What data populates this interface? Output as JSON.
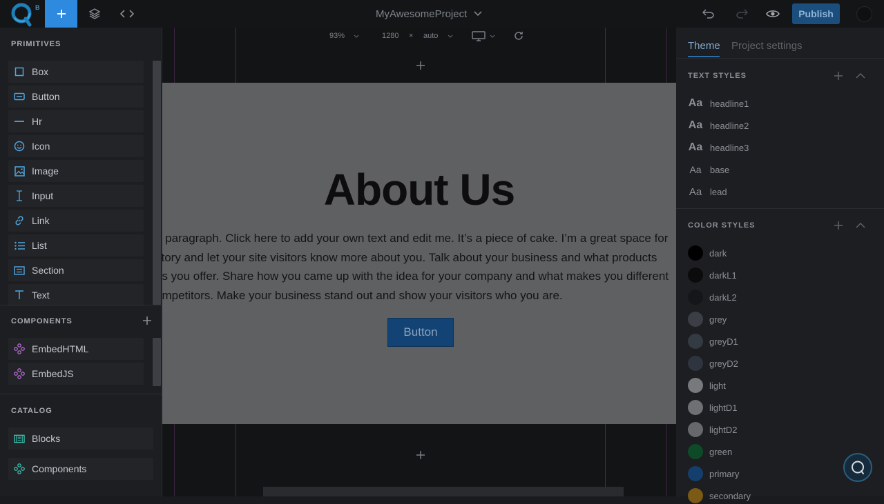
{
  "topbar": {
    "logo_badge": "B",
    "project_name": "MyAwesomeProject",
    "publish_label": "Publish"
  },
  "left_panel": {
    "primitives_title": "PRIMITIVES",
    "primitives": [
      {
        "label": "Box",
        "icon": "box-icon"
      },
      {
        "label": "Button",
        "icon": "button-icon"
      },
      {
        "label": "Hr",
        "icon": "hr-icon"
      },
      {
        "label": "Icon",
        "icon": "smiley-icon"
      },
      {
        "label": "Image",
        "icon": "image-icon"
      },
      {
        "label": "Input",
        "icon": "text-cursor-icon"
      },
      {
        "label": "Link",
        "icon": "link-icon"
      },
      {
        "label": "List",
        "icon": "list-icon"
      },
      {
        "label": "Section",
        "icon": "section-icon"
      },
      {
        "label": "Text",
        "icon": "text-icon"
      }
    ],
    "components_title": "COMPONENTS",
    "components": [
      {
        "label": "EmbedHTML",
        "icon": "component-icon"
      },
      {
        "label": "EmbedJS",
        "icon": "component-icon"
      }
    ],
    "catalog_title": "CATALOG",
    "catalog": [
      {
        "label": "Blocks",
        "icon": "blocks-icon"
      },
      {
        "label": "Components",
        "icon": "component-icon"
      }
    ]
  },
  "canvas": {
    "zoom": "93%",
    "width": "1280",
    "times": "×",
    "height": "auto",
    "page": {
      "title": "About Us",
      "paragraph_lines": [
        "a paragraph. Click here to add your own text and edit me. It’s a piece of cake. I’m a great space for",
        " story and let your site visitors know more about you. Talk about your business and what products",
        "es you offer. Share how you came up with the idea for your company and what makes you different",
        "ompetitors. Make your business stand out and show your visitors who you are."
      ],
      "button_label": "Button"
    }
  },
  "right_panel": {
    "tabs": [
      "Theme",
      "Project settings"
    ],
    "text_styles_title": "TEXT STYLES",
    "text_styles": [
      {
        "glyph": "Aa",
        "name": "headline1"
      },
      {
        "glyph": "Aa",
        "name": "headline2"
      },
      {
        "glyph": "Aa",
        "name": "headline3"
      },
      {
        "glyph": "Aa",
        "name": "base"
      },
      {
        "glyph": "Aa",
        "name": "lead"
      }
    ],
    "color_styles_title": "COLOR STYLES",
    "color_styles": [
      {
        "name": "dark",
        "color": "#000000"
      },
      {
        "name": "darkL1",
        "color": "#0b0b0c"
      },
      {
        "name": "darkL2",
        "color": "#151618"
      },
      {
        "name": "grey",
        "color": "#3b3f45"
      },
      {
        "name": "greyD1",
        "color": "#343a42"
      },
      {
        "name": "greyD2",
        "color": "#2f353e"
      },
      {
        "name": "light",
        "color": "#77797d"
      },
      {
        "name": "lightD1",
        "color": "#6e7074"
      },
      {
        "name": "lightD2",
        "color": "#66686c"
      },
      {
        "name": "green",
        "color": "#0f4a28"
      },
      {
        "name": "primary",
        "color": "#143f6c"
      },
      {
        "name": "secondary",
        "color": "#7a5a14"
      }
    ]
  },
  "colors": {
    "accent": "#2e8ade",
    "publish_bg": "#1c4e7d",
    "component_purple": "#b56ad6",
    "primitive_blue": "#4fa6e0",
    "catalog_teal": "#37c2b0"
  }
}
